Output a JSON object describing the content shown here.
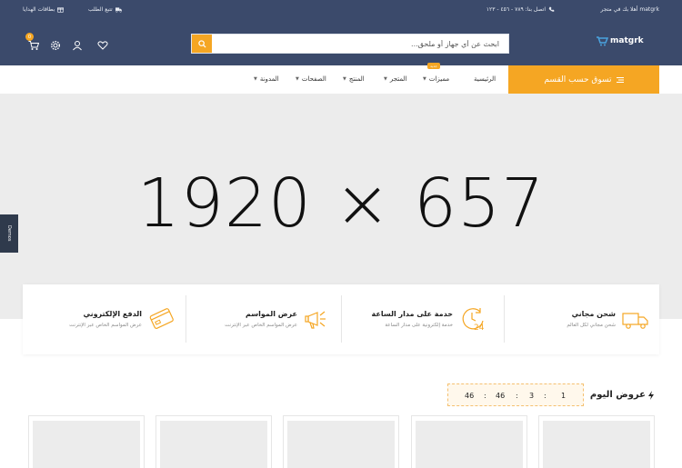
{
  "topbar": {
    "welcome": "أهلا بك في متجر matgrk",
    "phone": "اتصل بنا: ٧٨٩ - ٤٥٦ - ١٢٣",
    "track_order": "تتبع الطلب",
    "gift_cards": "بطاقات الهدايا"
  },
  "header": {
    "logo_text": "matgrk",
    "search_placeholder": "ابحث عن أي جهاز أو ملحق...",
    "cart_count": "0"
  },
  "nav": {
    "category_button": "تسوق حسب القسم",
    "items": [
      {
        "label": "الرئيسية",
        "dropdown": false
      },
      {
        "label": "مميزات",
        "dropdown": true,
        "badge": "جديد"
      },
      {
        "label": "المتجر",
        "dropdown": true
      },
      {
        "label": "المنتج",
        "dropdown": true
      },
      {
        "label": "الصفحات",
        "dropdown": true
      },
      {
        "label": "المدونة",
        "dropdown": true
      }
    ]
  },
  "hero": {
    "placeholder_text": "1920 × 657"
  },
  "side_tab": {
    "label": "Demos"
  },
  "features": [
    {
      "title": "شحن مجاني",
      "subtitle": "شحن مجاني لكل العالم",
      "icon": "truck-icon"
    },
    {
      "title": "خدمة على مدار الساعة",
      "subtitle": "خدمة إلكترونية على مدار الساعة",
      "icon": "clock-24-icon"
    },
    {
      "title": "عرض المواسم",
      "subtitle": "عرض المواسم الخاص عبر الإنترنت",
      "icon": "megaphone-icon"
    },
    {
      "title": "الدفع الإلكتروني",
      "subtitle": "عرض المواسم الخاص عبر الإنترنت",
      "icon": "credit-card-icon"
    }
  ],
  "deals": {
    "title": "عروض اليوم",
    "timer": {
      "days": "1",
      "hours": "3",
      "minutes": "46",
      "seconds": "46"
    }
  },
  "colors": {
    "header_bg": "#3b4a6b",
    "accent": "#f5a623",
    "hero_bg": "#ececec"
  }
}
